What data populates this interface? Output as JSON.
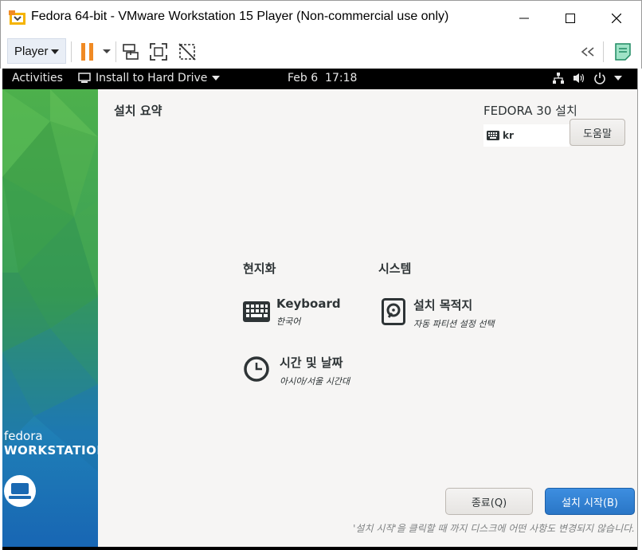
{
  "window": {
    "title": "Fedora 64-bit - VMware Workstation 15 Player (Non-commercial use only)"
  },
  "toolbar": {
    "player_label": "Player",
    "icons": [
      "pause-icon",
      "dropdown-icon",
      "send-ctrl-alt-del-icon",
      "fullscreen-icon",
      "unity-icon",
      "back-arrows-icon",
      "notes-icon"
    ]
  },
  "gnome_bar": {
    "activities": "Activities",
    "app_menu": "Install to Hard Drive",
    "clock": "Feb 6  17:18"
  },
  "installer": {
    "page_title": "설치 요약",
    "product_title": "FEDORA 30 설치",
    "keyboard_layout": "kr",
    "help_label": "도움말",
    "sidebar": {
      "brand_top": "fedora",
      "brand_bottom": "WORKSTATION"
    },
    "sections": [
      {
        "heading": "현지화",
        "spokes": [
          {
            "title": "Keyboard",
            "status": "한국어",
            "icon": "keyboard-icon"
          },
          {
            "title": "시간 및 날짜",
            "status": "아시아/서울 시간대",
            "icon": "clock-icon"
          }
        ]
      },
      {
        "heading": "시스템",
        "spokes": [
          {
            "title": "설치 목적지",
            "status": "자동 파티션 설정 선택",
            "icon": "disk-icon"
          }
        ]
      }
    ],
    "quit_label": "종료(Q)",
    "begin_label": "설치 시작(B)",
    "footnote": "'설치 시작'을 클릭할 때 까지 디스크에 어떤 사항도 변경되지 않습니다."
  },
  "colors": {
    "accent_blue": "#3584e4",
    "pause_orange": "#f08a24",
    "sidebar_green": "#3aa53f",
    "sidebar_blue": "#1c76c4"
  }
}
